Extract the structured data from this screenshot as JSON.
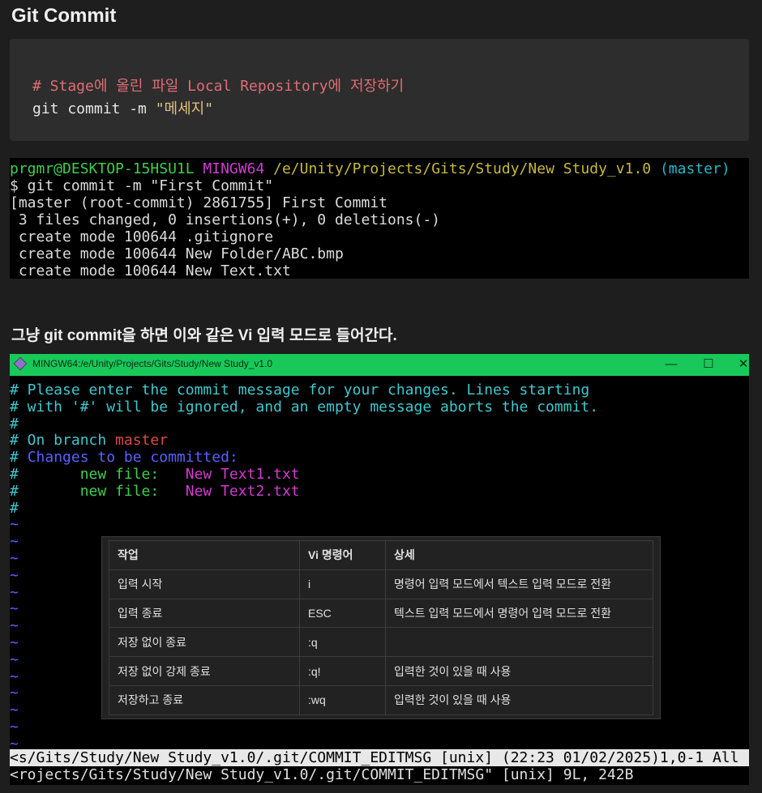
{
  "page": {
    "title": "Git Commit",
    "section_text": "그냥 git commit을 하면 이와 같은 Vi 입력 모드로 들어간다."
  },
  "code_block": {
    "comment": "# Stage에 올린 파일 Local Repository에 저장하기",
    "command_prefix": "git commit -m ",
    "command_string": "\"메세지\""
  },
  "terminal_1": {
    "prompt_user": "prgmr@DESKTOP-15HSU1L",
    "prompt_env": "MINGW64",
    "prompt_path": "/e/Unity/Projects/Gits/Study/New Study_v1.0",
    "prompt_branch": "(master)",
    "command": "$ git commit -m \"First Commit\"",
    "output": [
      "[master (root-commit) 2861755] First Commit",
      " 3 files changed, 0 insertions(+), 0 deletions(-)",
      " create mode 100644 .gitignore",
      " create mode 100644 New Folder/ABC.bmp",
      " create mode 100644 New Text.txt"
    ]
  },
  "vi_window": {
    "title": "MINGW64:/e/Unity/Projects/Gits/Study/New Study_v1.0",
    "controls": {
      "minimize": "—",
      "maximize": "☐",
      "close": "✕"
    },
    "lines": {
      "l1": "# Please enter the commit message for your changes. Lines starting",
      "l2": "# with '#' will be ignored, and an empty message aborts the commit.",
      "l3": "#",
      "l4_prefix": "# On branch ",
      "l4_branch": "master",
      "l5_hash": "# ",
      "l5_text": "Changes to be committed:",
      "l6_hash": "#",
      "l6_label": "       new file:   ",
      "l6_file": "New Text1.txt",
      "l7_hash": "#",
      "l7_label": "       new file:   ",
      "l7_file": "New Text2.txt",
      "l8": "#"
    },
    "tilde_char": "~",
    "status_line_1": "<s/Gits/Study/New Study_v1.0/.git/COMMIT_EDITMSG [unix] (22:23 01/02/2025)1,0-1 All",
    "status_line_2": "<rojects/Gits/Study/New Study_v1.0/.git/COMMIT_EDITMSG\" [unix] 9L, 242B"
  },
  "vi_table": {
    "headers": [
      "작업",
      "Vi 명령어",
      "상세"
    ],
    "rows": [
      [
        "입력 시작",
        "i",
        "명령어 입력 모드에서 텍스트 입력 모드로 전환"
      ],
      [
        "입력 종료",
        "ESC",
        "텍스트 입력 모드에서 명령어 입력 모드로 전환"
      ],
      [
        "저장 없이 종료",
        ":q",
        ""
      ],
      [
        "저장 없이 강제 종료",
        ":q!",
        "입력한 것이 있을 때 사용"
      ],
      [
        "저장하고 종료",
        ":wq",
        "입력한 것이 있을 때 사용"
      ]
    ]
  }
}
